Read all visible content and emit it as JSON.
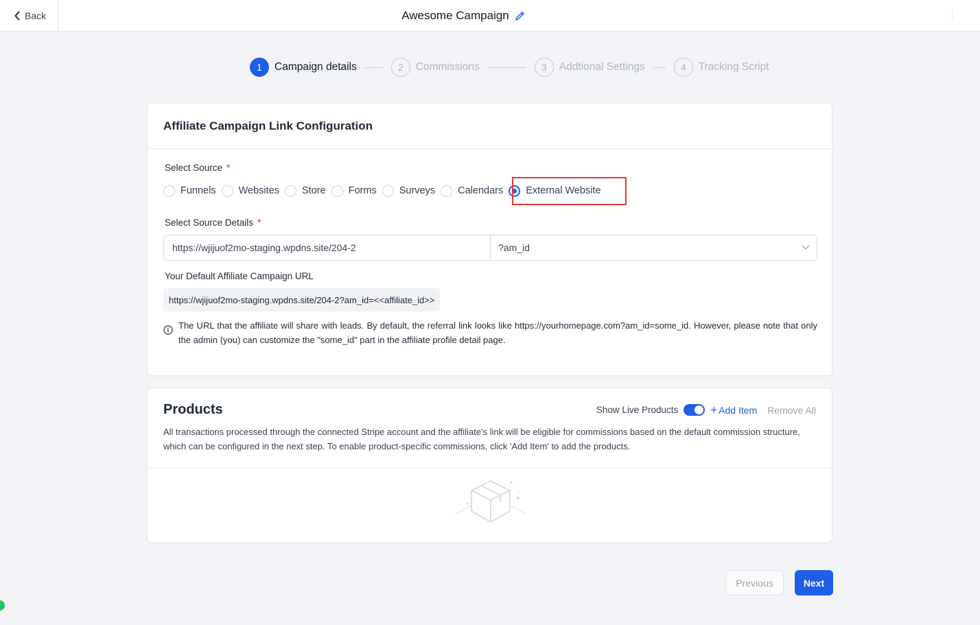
{
  "header": {
    "back_label": "Back",
    "title": "Awesome Campaign"
  },
  "stepper": {
    "steps": [
      {
        "number": "1",
        "label": "Campaign details",
        "active": true
      },
      {
        "number": "2",
        "label": "Commissions",
        "active": false
      },
      {
        "number": "3",
        "label": "Addtional Settings",
        "active": false
      },
      {
        "number": "4",
        "label": "Tracking Script",
        "active": false
      }
    ]
  },
  "link_config": {
    "title": "Affiliate Campaign Link Configuration",
    "select_source_label": "Select Source",
    "required_mark": "*",
    "sources": [
      {
        "label": "Funnels",
        "selected": false
      },
      {
        "label": "Websites",
        "selected": false
      },
      {
        "label": "Store",
        "selected": false
      },
      {
        "label": "Forms",
        "selected": false
      },
      {
        "label": "Surveys",
        "selected": false
      },
      {
        "label": "Calendars",
        "selected": false
      },
      {
        "label": "External Website",
        "selected": true
      }
    ],
    "source_details_label": "Select Source Details",
    "source_url_value": "https://wjijuof2mo-staging.wpdns.site/204-2",
    "param_value": "?am_id",
    "default_url_label": "Your Default Affiliate Campaign URL",
    "default_url_value": "https://wjijuof2mo-staging.wpdns.site/204-2?am_id=<<affiliate_id>>",
    "info_text": "The URL that the affiliate will share with leads. By default, the referral link looks like https://yourhomepage.com?am_id=some_id. However, please note that only the admin (you) can customize the \"some_id\" part in the affiliate profile detail page."
  },
  "products": {
    "title": "Products",
    "show_live_label": "Show Live Products",
    "show_live_enabled": true,
    "add_item_label": "Add Item",
    "add_item_plus": "+",
    "remove_all_label": "Remove All",
    "description": "All transactions processed through the connected Stripe account and the affiliate's link will be eligible for commissions based on the default commission structure, which can be configured in the next step. To enable product-specific commissions, click 'Add Item' to add the products."
  },
  "footer": {
    "previous_label": "Previous",
    "next_label": "Next"
  },
  "colors": {
    "accent": "#1d5fe9",
    "highlight_border": "#e53935",
    "required": "#e11d48",
    "status_dot": "#22c55e"
  },
  "icons": {
    "back": "chevron-left-icon",
    "edit": "pencil-icon",
    "info": "info-circle-icon",
    "dropdown": "chevron-down-icon",
    "empty_state": "empty-box-icon"
  }
}
